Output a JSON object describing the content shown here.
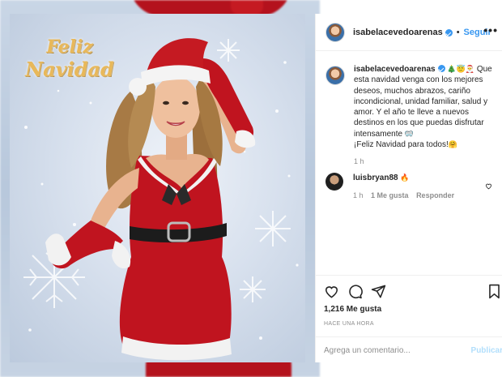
{
  "photo": {
    "greeting_line1": "Feliz",
    "greeting_line2": "Navidad"
  },
  "header": {
    "username": "isabelacevedoarenas",
    "separator": "•",
    "follow_label": "Seguir",
    "more_label": "•••"
  },
  "caption": {
    "username": "isabelacevedoarenas",
    "emojis": [
      "🎄",
      "😇",
      "🎅"
    ],
    "text": "Que esta navidad venga con los mejores deseos, muchos abrazos, cariño incondicional, unidad familiar, salud y amor. Y el año te lleve a nuevos destinos en los que puedas disfrutar intensamente",
    "text_emoji": "🥽",
    "closing": "¡Feliz Navidad para todos!",
    "closing_emoji": "🤗",
    "time": "1 h"
  },
  "comment": {
    "username": "luisbryan88",
    "emoji": "🔥",
    "time": "1 h",
    "likes": "1 Me gusta",
    "reply_label": "Responder"
  },
  "actions": {
    "likes": "1,216 Me gusta",
    "time_ago": "HACE UNA HORA",
    "comment_placeholder": "Agrega un comentario...",
    "publish_label": "Publicar"
  },
  "colors": {
    "accent": "#3897f0",
    "publish_disabled": "#b2dffc",
    "muted": "#8e8e8e",
    "dress_red": "#c0141f"
  },
  "icons": [
    "heart-icon",
    "comment-icon",
    "share-icon",
    "bookmark-icon",
    "verified-icon",
    "more-icon"
  ]
}
